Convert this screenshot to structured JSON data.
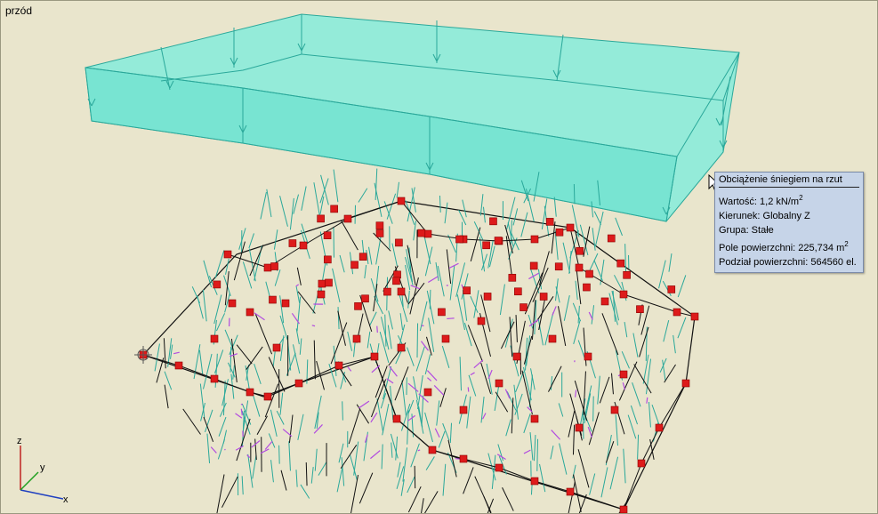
{
  "view": {
    "label": "przód"
  },
  "tooltip": {
    "title": "Obciążenie śniegiem na rzut",
    "value_label": "Wartość: 1,2 kN/m",
    "value_sup": "2",
    "direction": "Kierunek: Globalny Z",
    "group": "Grupa: Stałe",
    "area_label": "Pole powierzchni: 225,734 m",
    "area_sup": "2",
    "division": "Podział powierzchni: 564560 el."
  },
  "axes": {
    "x": "x",
    "y": "y",
    "z": "z"
  },
  "colors": {
    "background": "#e9e5cc",
    "load_fill": "#7ee8d8",
    "load_stroke": "#2aa89a",
    "node": "#dd1b1b",
    "member": "#111111",
    "support": "#b24be0",
    "tooltip_bg": "#c6d4e8"
  }
}
